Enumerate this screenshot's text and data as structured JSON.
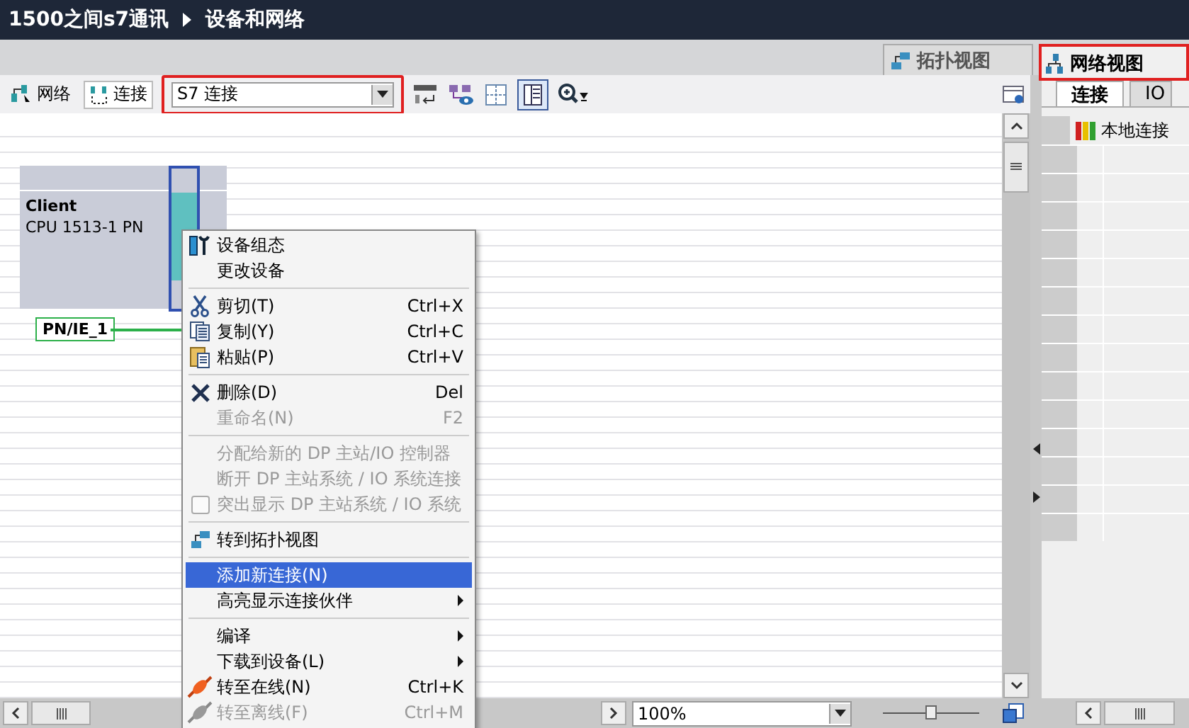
{
  "breadcrumb": [
    "1500之间s7通讯",
    "设备和网络"
  ],
  "view_tabs": [
    {
      "label": "拓扑视图",
      "selected": false
    },
    {
      "label": "网络视图",
      "selected": true
    }
  ],
  "toolbar": {
    "network_button": "网络",
    "connection_button": "连接",
    "connection_type": "S7 连接"
  },
  "device": {
    "name": "Client",
    "model": "CPU 1513-1 PN",
    "selected": true
  },
  "subnet": "PN/IE_1",
  "context_menu": [
    {
      "kind": "item",
      "label": "设备组态",
      "disabled": false,
      "selected": false
    },
    {
      "kind": "item",
      "label": "更改设备",
      "disabled": false,
      "selected": false
    },
    {
      "kind": "separator"
    },
    {
      "kind": "item",
      "label": "剪切(T)",
      "shortcut": "Ctrl+X",
      "disabled": false,
      "selected": false
    },
    {
      "kind": "item",
      "label": "复制(Y)",
      "shortcut": "Ctrl+C",
      "disabled": false,
      "selected": false
    },
    {
      "kind": "item",
      "label": "粘贴(P)",
      "shortcut": "Ctrl+V",
      "disabled": false,
      "selected": false
    },
    {
      "kind": "separator"
    },
    {
      "kind": "item",
      "label": "删除(D)",
      "shortcut": "Del",
      "disabled": false,
      "selected": false
    },
    {
      "kind": "item",
      "label": "重命名(N)",
      "shortcut": "F2",
      "disabled": true,
      "selected": false
    },
    {
      "kind": "separator"
    },
    {
      "kind": "item",
      "label": "分配给新的 DP 主站/IO 控制器",
      "disabled": true,
      "selected": false
    },
    {
      "kind": "item",
      "label": "断开 DP 主站系统 / IO 系统连接",
      "disabled": true,
      "selected": false
    },
    {
      "kind": "checkbox",
      "label": "突出显示 DP 主站系统 / IO 系统",
      "checked": false,
      "disabled": true,
      "selected": false
    },
    {
      "kind": "separator"
    },
    {
      "kind": "item",
      "label": "转到拓扑视图",
      "disabled": false,
      "selected": false
    },
    {
      "kind": "separator"
    },
    {
      "kind": "item",
      "label": "添加新连接(N)",
      "disabled": false,
      "selected": true
    },
    {
      "kind": "item",
      "label": "高亮显示连接伙伴",
      "submenu": true,
      "disabled": false,
      "selected": false
    },
    {
      "kind": "separator"
    },
    {
      "kind": "item",
      "label": "编译",
      "submenu": true,
      "disabled": false,
      "selected": false
    },
    {
      "kind": "item",
      "label": "下载到设备(L)",
      "submenu": true,
      "disabled": false,
      "selected": false
    },
    {
      "kind": "item",
      "label": "转至在线(N)",
      "shortcut": "Ctrl+K",
      "disabled": false,
      "selected": false
    },
    {
      "kind": "item",
      "label": "转至离线(F)",
      "shortcut": "Ctrl+M",
      "disabled": true,
      "selected": false
    }
  ],
  "zoom": {
    "value": "100%",
    "level": 0.5
  },
  "right_panel": {
    "tabs": [
      {
        "label": "连接",
        "selected": true
      },
      {
        "label": "IO",
        "selected": false
      }
    ],
    "column": "本地连接"
  }
}
